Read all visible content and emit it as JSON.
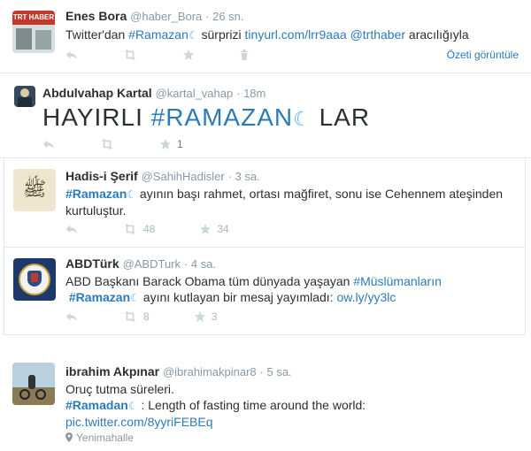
{
  "tweets": [
    {
      "fullname": "Enes Bora",
      "username": "@haber_Bora",
      "time": "· 26 sn.",
      "text_prefix": "Twitter'dan ",
      "hashtag": "#Ramazan",
      "text_mid": " sürprizi ",
      "link": "tinyurl.com/lrr9aaa",
      "mention": "@trthaber",
      "text_suffix": " aracılığıyla",
      "summary": "Özeti görüntüle",
      "avatar_text": "TRT HABER"
    },
    {
      "fullname": "Abdulvahap Kartal",
      "username": "@kartal_vahap",
      "time": "· 18m",
      "big_prefix": "HAYIRLI ",
      "big_hashtag": "#RAMAZAN",
      "big_suffix": " LAR",
      "favorites": "1"
    },
    {
      "fullname": "Hadis-i Şerif",
      "username": "@SahihHadisler",
      "time": "· 3 sa.",
      "hashtag": "#Ramazan",
      "text": "  ayının başı rahmet, ortası mağfiret, sonu ise Cehennem ateşinden",
      "text2": "kurtuluştur.",
      "retweets": "48",
      "favorites": "34"
    },
    {
      "fullname": "ABDTürk",
      "username": "@ABDTurk",
      "time": "· 4 sa.",
      "text1": "ABD Başkanı Barack Obama tüm dünyada yaşayan ",
      "hashtag1": "#Müslümanların",
      "hashtag2": "#Ramazan",
      "text2": "  ayını kutlayan bir mesaj yayımladı: ",
      "link": "ow.ly/yy3lc",
      "retweets": "8",
      "favorites": "3"
    },
    {
      "fullname": "ibrahim Akpınar",
      "username": "@ibrahimakpinar8",
      "time": "· 5 sa.",
      "text1": "Oruç tutma süreleri.",
      "hashtag": "#Ramadan",
      "text2": " : Length of fasting time around the world:",
      "link": "pic.twitter.com/8yyriFEBEq",
      "location": "Yenimahalle"
    }
  ],
  "colors": {
    "link": "#2b7bb9",
    "moon": "#55acee",
    "muted": "#8899a6",
    "action": "#ccd6dd"
  },
  "icons": {
    "reply": "reply-icon",
    "retweet": "retweet-icon",
    "favorite": "star-icon",
    "delete": "trash-icon",
    "location": "location-pin-icon",
    "moon": "crescent-moon-icon"
  }
}
